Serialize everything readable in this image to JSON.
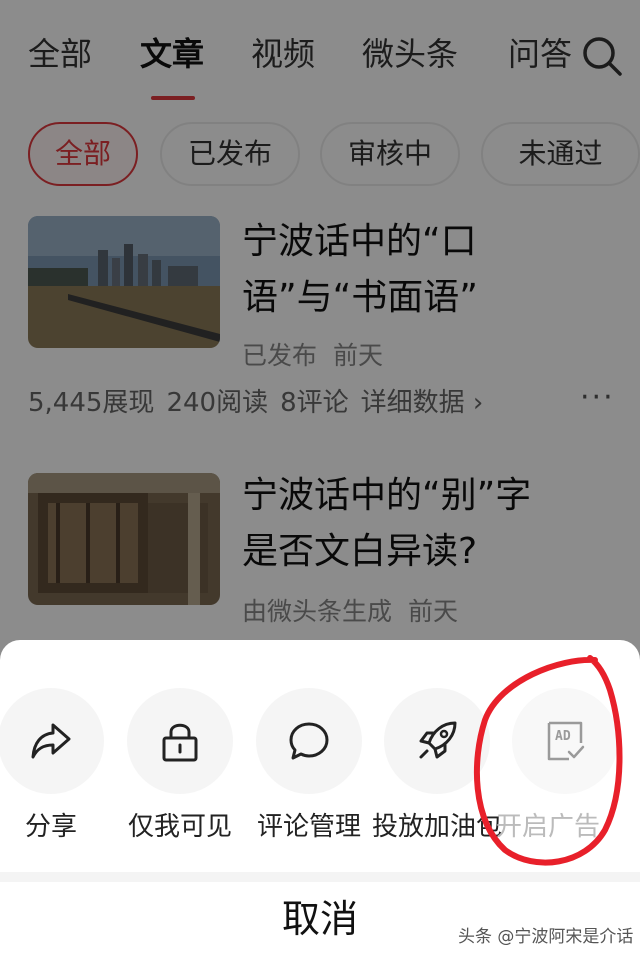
{
  "tabs": [
    {
      "label": "全部"
    },
    {
      "label": "文章"
    },
    {
      "label": "视频"
    },
    {
      "label": "微头条"
    },
    {
      "label": "问答"
    }
  ],
  "filters": [
    {
      "label": "全部"
    },
    {
      "label": "已发布"
    },
    {
      "label": "审核中"
    },
    {
      "label": "未通过"
    }
  ],
  "articles": [
    {
      "title_line1": "宁波话中的“口",
      "title_line2": "语”与“书面语”",
      "status": "已发布",
      "time": "前天",
      "stats": {
        "views": "5,445展现",
        "reads": "240阅读",
        "comments": "8评论",
        "detail": "详细数据 ›"
      },
      "more": "···"
    },
    {
      "title_line1": "宁波话中的“别”字",
      "title_line2": "是否文白异读?",
      "status": "由微头条生成",
      "time": "前天"
    }
  ],
  "sheet": {
    "actions": [
      {
        "label": "分享",
        "icon": "share-icon"
      },
      {
        "label": "仅我可见",
        "icon": "lock-icon"
      },
      {
        "label": "评论管理",
        "icon": "comment-icon"
      },
      {
        "label": "投放加油包",
        "icon": "rocket-icon"
      },
      {
        "label": "开启广告",
        "icon": "ad-icon",
        "badge": "AD"
      }
    ],
    "cancel_label": "取消"
  },
  "watermark": "头条 @宁波阿宋是介话",
  "colors": {
    "accent": "#e0393e",
    "annotation": "#e8202a"
  }
}
